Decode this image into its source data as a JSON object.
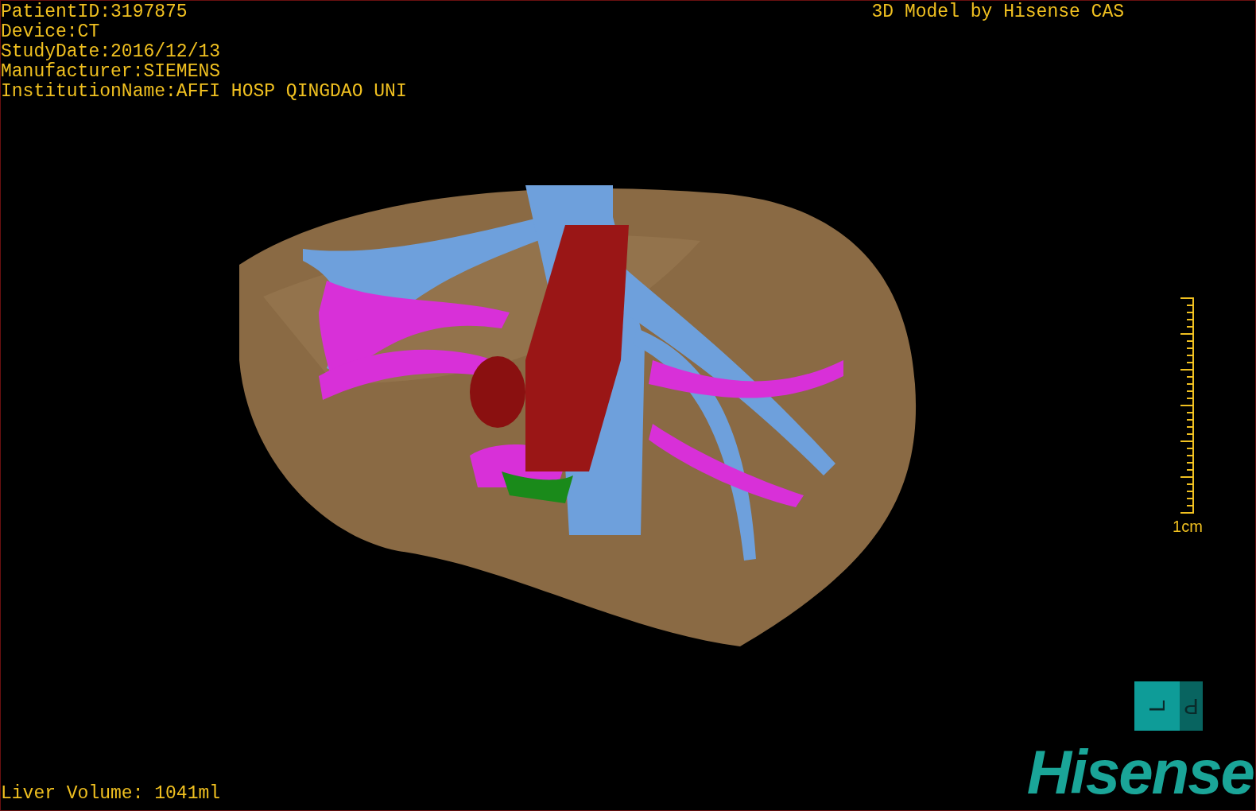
{
  "study_info": [
    "PatientID:3197875",
    "Device:CT",
    "StudyDate:2016/12/13",
    "Manufacturer:SIEMENS",
    "InstitutionName:AFFI HOSP QINGDAO UNI"
  ],
  "title": "3D Model by Hisense CAS",
  "scale_bar": {
    "label": "1cm"
  },
  "liver_volume": "Liver Volume: 1041ml",
  "orientation_cube": {
    "faces": [
      {
        "kind": "front",
        "label": "L"
      },
      {
        "kind": "side",
        "label": "P"
      }
    ]
  },
  "logo": "Hisense"
}
